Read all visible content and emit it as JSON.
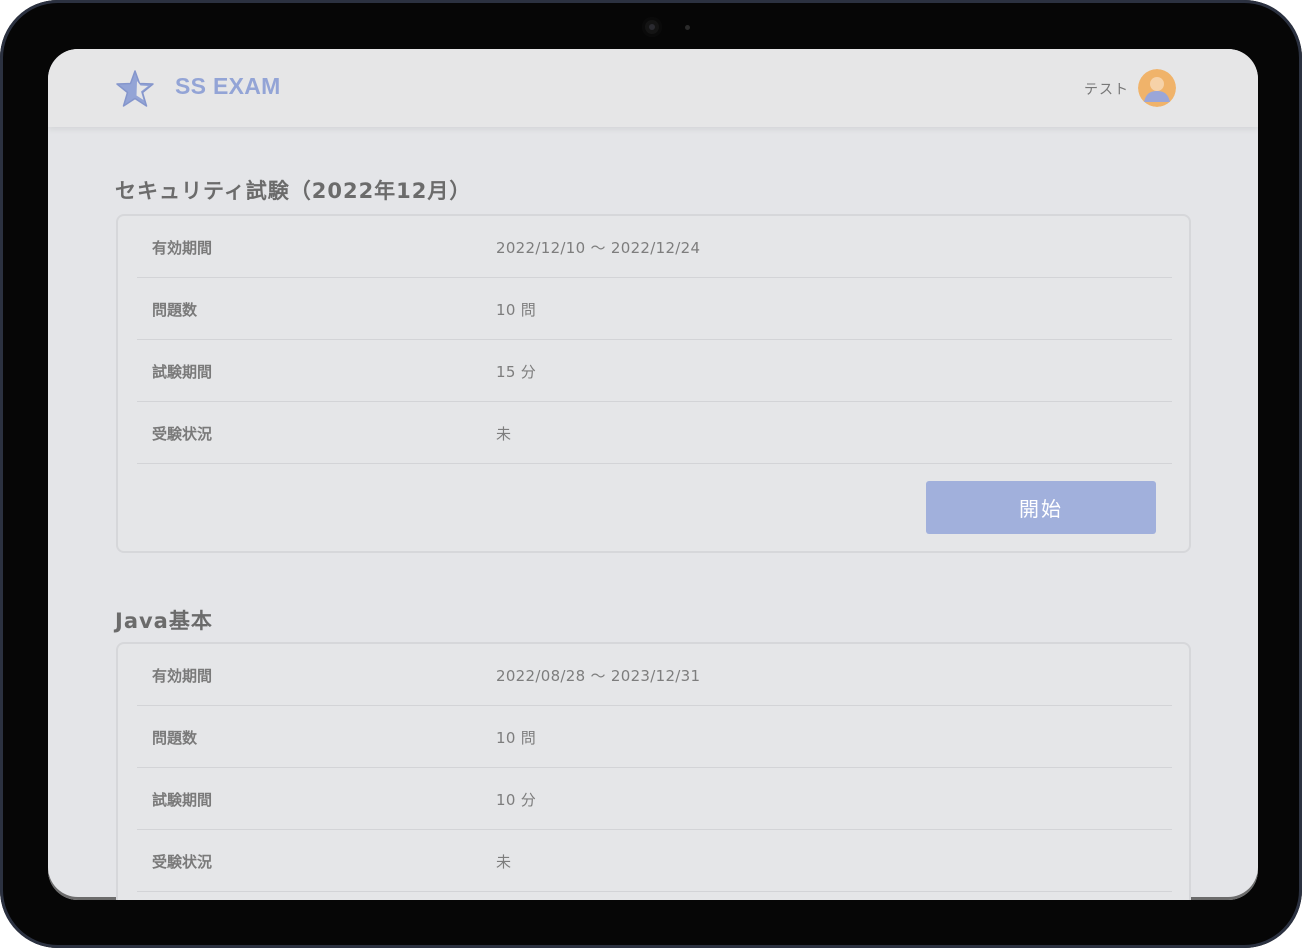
{
  "header": {
    "brand": "SS EXAM",
    "user_name": "テスト"
  },
  "exams": [
    {
      "title": "セキュリティ試験（2022年12月）",
      "rows": [
        {
          "label": "有効期間",
          "value": "2022/12/10 ～ 2022/12/24"
        },
        {
          "label": "問題数",
          "value": "10 問"
        },
        {
          "label": "試験期間",
          "value": "15 分"
        },
        {
          "label": "受験状況",
          "value": "未"
        }
      ],
      "button": "開始"
    },
    {
      "title": "Java基本",
      "rows": [
        {
          "label": "有効期間",
          "value": "2022/08/28 ～ 2023/12/31"
        },
        {
          "label": "問題数",
          "value": "10 問"
        },
        {
          "label": "試験期間",
          "value": "10 分"
        },
        {
          "label": "受験状況",
          "value": "未"
        }
      ]
    }
  ],
  "colors": {
    "accent": "#93a4d6",
    "button": "#a1b0dc",
    "avatar_bg": "#f0b36a",
    "avatar_person": "#9aa6d8"
  }
}
